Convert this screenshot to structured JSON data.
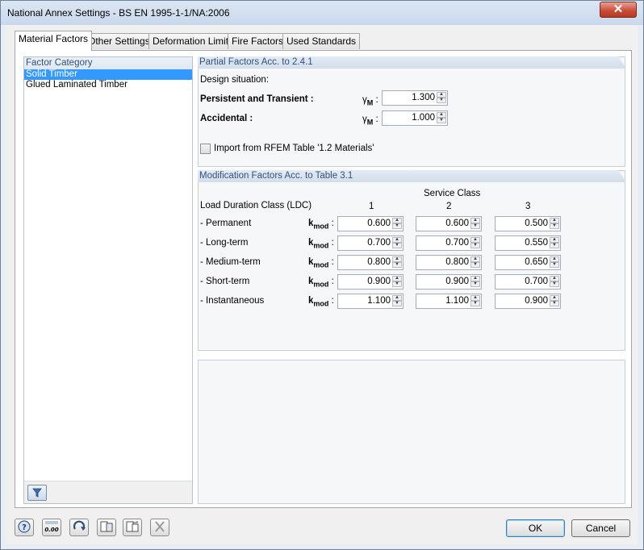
{
  "window": {
    "title": "National Annex Settings - BS EN 1995-1-1/NA:2006",
    "close_glyph": "✕"
  },
  "tabs": [
    {
      "label": "Material Factors"
    },
    {
      "label": "Other Settings"
    },
    {
      "label": "Deformation Limits"
    },
    {
      "label": "Fire Factors"
    },
    {
      "label": "Used Standards"
    }
  ],
  "factor_category": {
    "header": "Factor Category",
    "items": [
      {
        "label": "Solid Timber",
        "selected": true
      },
      {
        "label": "Glued Laminated Timber",
        "selected": false
      }
    ]
  },
  "partial_factors": {
    "header": "Partial Factors Acc. to 2.4.1",
    "design_situation_label": "Design situation:",
    "rows": [
      {
        "label": "Persistent and Transient :",
        "symbol": "γ",
        "symbol_sub": "M",
        "suffix": " :",
        "value": "1.300"
      },
      {
        "label": "Accidental :",
        "symbol": "γ",
        "symbol_sub": "M",
        "suffix": " :",
        "value": "1.000"
      }
    ],
    "import_checkbox_label": "Import from RFEM Table '1.2 Materials'",
    "import_checked": false
  },
  "modification_factors": {
    "header": "Modification Factors Acc. to Table 3.1",
    "service_class_label": "Service Class",
    "ldc_label": "Load Duration Class (LDC)",
    "columns": [
      "1",
      "2",
      "3"
    ],
    "symbol": "k",
    "symbol_sub": "mod",
    "suffix": " :",
    "rows": [
      {
        "label": "- Permanent",
        "values": [
          "0.600",
          "0.600",
          "0.500"
        ]
      },
      {
        "label": "- Long-term",
        "values": [
          "0.700",
          "0.700",
          "0.550"
        ]
      },
      {
        "label": "- Medium-term",
        "values": [
          "0.800",
          "0.800",
          "0.650"
        ]
      },
      {
        "label": "- Short-term",
        "values": [
          "0.900",
          "0.900",
          "0.700"
        ]
      },
      {
        "label": "- Instantaneous",
        "values": [
          "1.100",
          "1.100",
          "0.900"
        ]
      }
    ]
  },
  "toolbar": {
    "icons": [
      "help-icon",
      "decimal-places-icon",
      "reset-icon",
      "copy-icon",
      "paste-icon",
      "delete-icon"
    ],
    "decimal_label": "0.00",
    "ok_label": "OK",
    "cancel_label": "Cancel"
  }
}
